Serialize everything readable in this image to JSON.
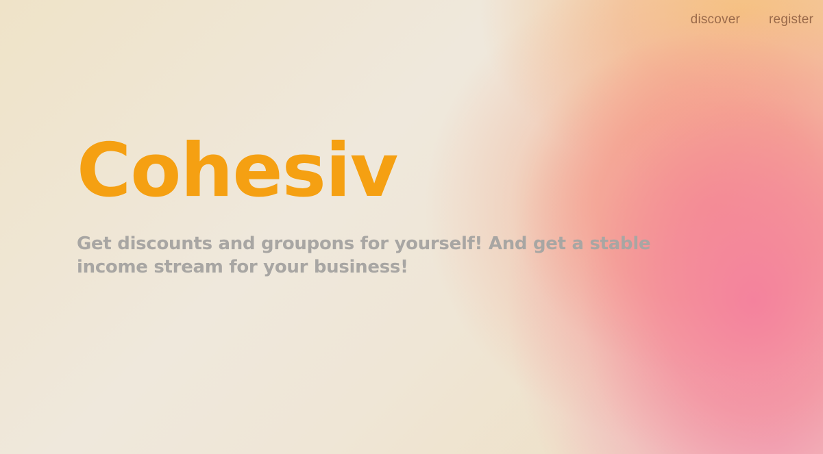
{
  "nav": {
    "items": [
      {
        "label": "discover"
      },
      {
        "label": "register"
      }
    ]
  },
  "hero": {
    "brand": "Cohesiv",
    "tagline": "Get discounts and groupons for yourself! And get a stable income stream for your business!"
  },
  "colors": {
    "brand": "#f5a012",
    "tagline": "#a8a6a3",
    "nav": "#9a6a4a"
  }
}
